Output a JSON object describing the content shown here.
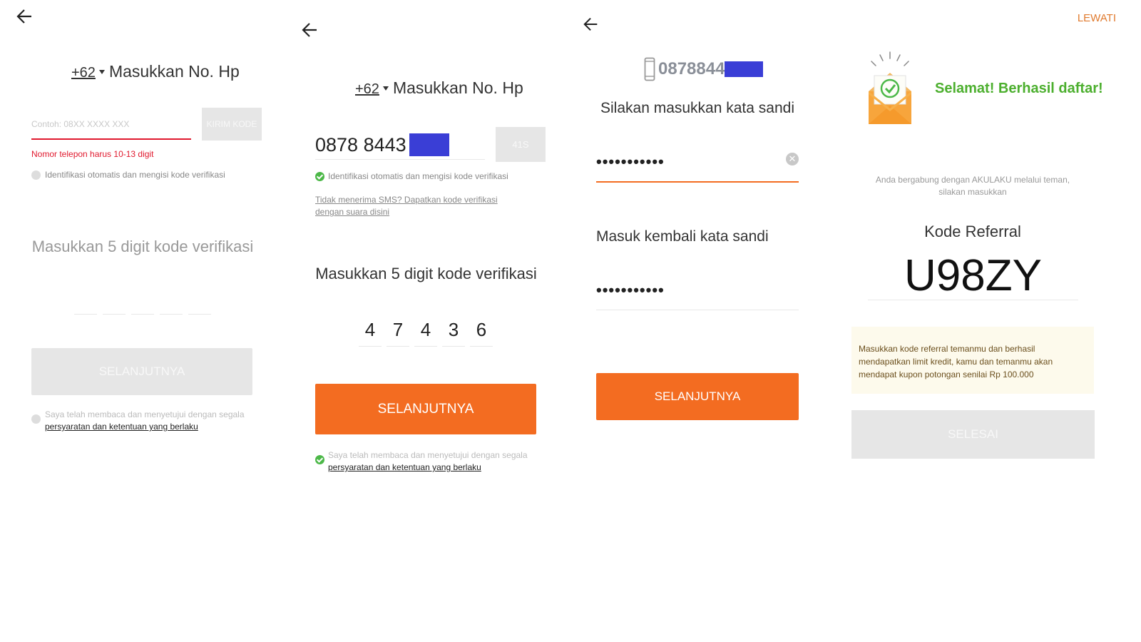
{
  "colors": {
    "accent": "#f36c21",
    "error": "#e0182d",
    "success": "#4cb848",
    "disabled": "#e6e6e6",
    "redacted": "#3a3ed6",
    "notice_bg": "#fdfaec",
    "title_green": "#4caf2e"
  },
  "screen1": {
    "back_icon": "arrow-left-icon",
    "country_code": "+62",
    "phone_label": "Masukkan No. Hp",
    "phone_placeholder": "Contoh: 08XX XXXX XXX",
    "send_code_label": "KIRIM KODE",
    "error_text": "Nomor telepon harus 10-13 digit",
    "auto_detect_text": "Identifikasi otomatis dan mengisi kode verifikasi",
    "code_title": "Masukkan 5 digit kode verifikasi",
    "next_label": "SELANJUTNYA",
    "terms_text": "Saya telah membaca dan menyetujui dengan segala",
    "terms_link": "persyaratan dan ketentuan yang berlaku"
  },
  "screen2": {
    "back_icon": "arrow-left-icon",
    "country_code": "+62",
    "phone_label": "Masukkan No. Hp",
    "phone_value": "0878 8443",
    "countdown": "41S",
    "auto_detect_text": "Identifikasi otomatis dan mengisi kode verifikasi",
    "voice_link": "Tidak menerima SMS? Dapatkan kode verifikasi dengan suara disini",
    "code_title": "Masukkan 5 digit kode verifikasi",
    "digits": [
      "4",
      "7",
      "4",
      "3",
      "6"
    ],
    "next_label": "SELANJUTNYA",
    "terms_text": "Saya telah membaca dan menyetujui dengan segala",
    "terms_link": "persyaratan dan ketentuan yang berlaku"
  },
  "screen3": {
    "back_icon": "arrow-left-icon",
    "phone_icon": "smartphone-icon",
    "phone_value": "0878844",
    "password_prompt": "Silakan masukkan kata sandi",
    "password_value": "•••••••••••",
    "clear_icon": "clear-icon",
    "confirm_label": "Masuk kembali kata sandi",
    "confirm_value": "•••••••••••",
    "next_label": "SELANJUTNYA"
  },
  "screen4": {
    "skip_label": "LEWATI",
    "envelope_icon": "envelope-check-icon",
    "success_title": "Selamat! Berhasil daftar!",
    "invite_text": "Anda bergabung dengan AKULAKU melalui teman, silakan masukkan",
    "referral_label": "Kode Referral",
    "referral_code": "U98ZY",
    "notice_text": "Masukkan kode referral temanmu dan berhasil mendapatkan limit kredit, kamu dan temanmu akan mendapat kupon potongan senilai Rp 100.000",
    "finish_label": "SELESAI"
  }
}
